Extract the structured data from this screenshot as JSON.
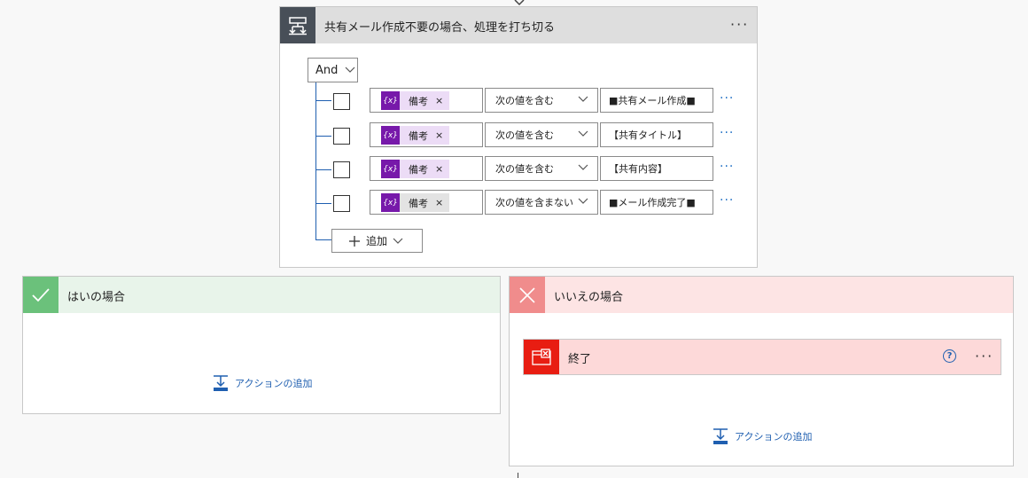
{
  "condition": {
    "title": "共有メール作成不要の場合、処理を打ち切る",
    "more_label": "···",
    "logic_operator": "And",
    "rows": [
      {
        "token_label": "備考",
        "token_remove": "×",
        "operator": "次の値を含む",
        "value": "■共有メール作成■",
        "more": "···"
      },
      {
        "token_label": "備考",
        "token_remove": "×",
        "operator": "次の値を含む",
        "value": "【共有タイトル】",
        "more": "···"
      },
      {
        "token_label": "備考",
        "token_remove": "×",
        "operator": "次の値を含む",
        "value": "【共有内容】",
        "more": "···"
      },
      {
        "token_label": "備考",
        "token_remove": "×",
        "operator": "次の値を含まない",
        "value": "■メール作成完了■",
        "more": "···"
      }
    ],
    "token_icon_text": "{x}",
    "add_label": "追加"
  },
  "yes_branch": {
    "title": "はいの場合",
    "add_action_label": "アクションの追加"
  },
  "no_branch": {
    "title": "いいえの場合",
    "terminate": {
      "title": "終了",
      "help_label": "?",
      "more_label": "···"
    },
    "add_action_label": "アクションの追加"
  },
  "colors": {
    "condition_icon_bg": "#484f58",
    "variable_token": "#7719aa",
    "yes_accent": "#6bc17b",
    "no_accent": "#f08c8c",
    "terminate_accent": "#e81d12",
    "link_blue": "#1f5fb0"
  }
}
